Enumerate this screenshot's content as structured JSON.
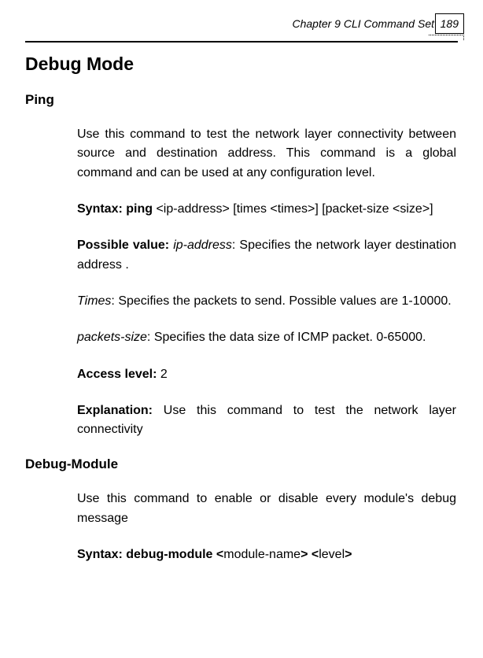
{
  "header": {
    "chapter_label": "Chapter 9 CLI Command Set",
    "page_number": "189"
  },
  "h1": "Debug Mode",
  "section1": {
    "heading": "Ping",
    "p1": "Use this command to test the network layer connectivity between source and destination address. This command is a global command and can be used at any configuration level.",
    "syntax_label": "Syntax: ping ",
    "syntax_rest": "<ip-address> [times <times>] [packet-size <size>]",
    "possible_value_label": "Possible value: ",
    "possible_value_param": "ip-address",
    "possible_value_rest": ": Specifies the network layer destination address .",
    "times_param": "Times",
    "times_rest": ": Specifies the packets to send. Possible values are 1-10000.",
    "packets_param": "packets-size",
    "packets_rest": ": Specifies the data size of ICMP packet. 0-65000.",
    "access_label": "Access level: ",
    "access_value": "2",
    "explanation_label": "Explanation: ",
    "explanation_rest": "Use this command to test the network layer connectivity"
  },
  "section2": {
    "heading": "Debug-Module",
    "p1": "Use this command to enable or disable every module's debug message",
    "syntax_label": "Syntax: debug-module <",
    "syntax_mid1": "module-name",
    "syntax_mid2": "> <",
    "syntax_mid3": "level",
    "syntax_end": ">"
  }
}
